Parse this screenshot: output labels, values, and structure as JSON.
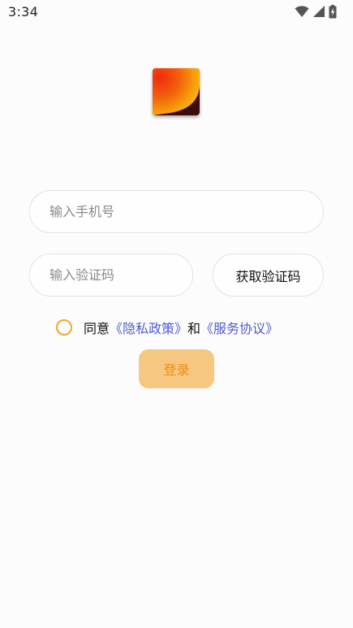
{
  "status_bar": {
    "time": "3:34",
    "icons": [
      "wifi-icon",
      "cellular-signal-icon",
      "battery-charging-icon"
    ]
  },
  "logo": {
    "icon": "app-logo-icon"
  },
  "form": {
    "phone_placeholder": "输入手机号",
    "phone_value": "",
    "code_placeholder": "输入验证码",
    "code_value": "",
    "get_code_label": "获取验证码"
  },
  "agreement": {
    "checked": false,
    "prefix": "同意",
    "privacy_link": "《隐私政策》",
    "conjunction": "和",
    "service_link": "《服务协议》"
  },
  "login": {
    "label": "登录"
  },
  "colors": {
    "accent": "#f0a830",
    "link": "#4f5bd5",
    "login_bg": "#f5c780",
    "login_text": "#f08c12"
  }
}
